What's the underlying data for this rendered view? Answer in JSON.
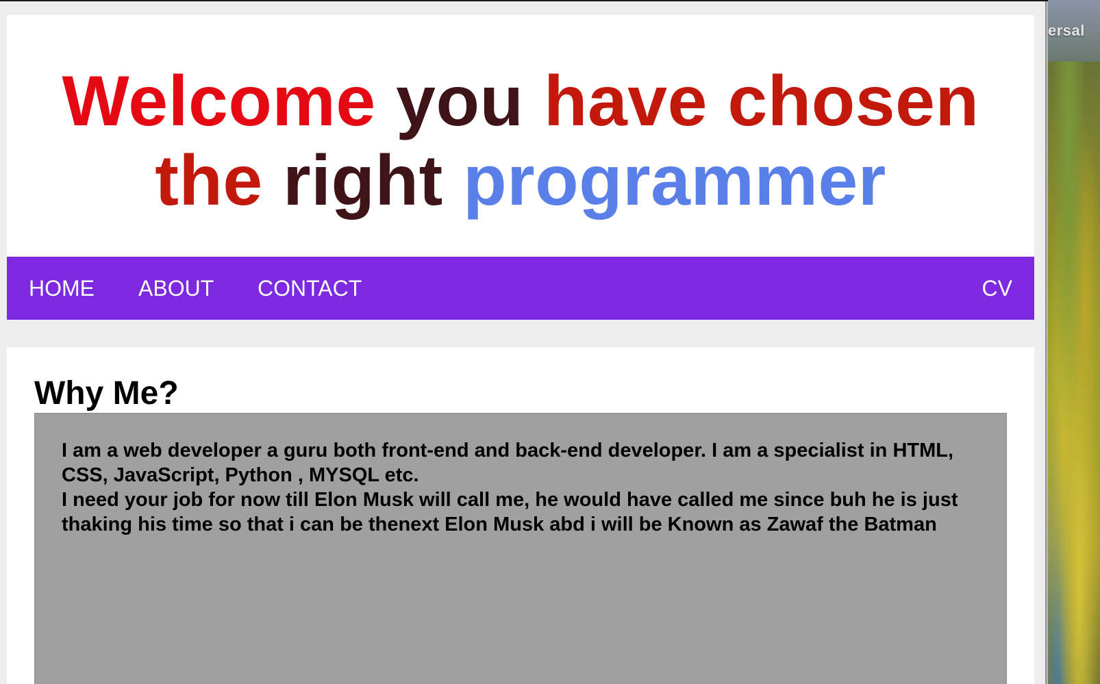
{
  "hero": {
    "words": [
      {
        "text": "Welcome",
        "color": "#e50914"
      },
      {
        "text": "you",
        "color": "#3f1418"
      },
      {
        "text": "have chosen",
        "color": "#c3180c"
      },
      {
        "text": "the",
        "color": "#c3180c"
      },
      {
        "text": "right",
        "color": "#3f1418"
      },
      {
        "text": "programmer",
        "color": "#5b7fe8"
      }
    ]
  },
  "nav": {
    "background": "#7d28e1",
    "home": "HOME",
    "about": "ABOUT",
    "contact": "CONTACT",
    "cv": "CV"
  },
  "section": {
    "title": "Why Me?",
    "box_color": "#a0a0a0",
    "paragraph_1": "I am a web developer a guru both front-end and back-end developer. I am a specialist in HTML, CSS, JavaScript, Python , MYSQL etc.",
    "paragraph_2": "I need your job for now till Elon Musk will call me, he would have called me since buh he is just thaking his time so that i can be thenext Elon Musk abd i will be Known as Zawaf the Batman"
  },
  "desktop": {
    "partial_label": "ersal"
  }
}
